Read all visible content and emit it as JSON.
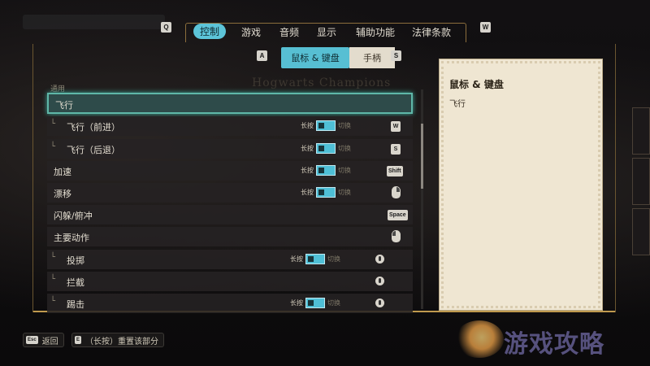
{
  "top_tabs": {
    "prev_key": "Q",
    "next_key": "W",
    "items": [
      {
        "label": "控制",
        "active": true
      },
      {
        "label": "游戏",
        "active": false
      },
      {
        "label": "音频",
        "active": false
      },
      {
        "label": "显示",
        "active": false
      },
      {
        "label": "辅助功能",
        "active": false
      },
      {
        "label": "法律条款",
        "active": false
      }
    ]
  },
  "sub_tabs": {
    "prev_key": "A",
    "next_key": "S",
    "active_label": "鼠标 & 键盘",
    "inactive_label": "手柄"
  },
  "list": {
    "section_label": "通用",
    "watermark_title": "Hogwarts Champions",
    "rows": [
      {
        "label": "飞行",
        "selected": true
      },
      {
        "label": "飞行（前进）",
        "sub": true,
        "toggle": {
          "hold": "长按",
          "alt": "切换"
        },
        "key": "W"
      },
      {
        "label": "飞行（后退）",
        "sub": true,
        "toggle": {
          "hold": "长按",
          "alt": "切换"
        },
        "key": "S"
      },
      {
        "label": "加速",
        "toggle": {
          "hold": "长按",
          "alt": "切换"
        },
        "key": "Shift"
      },
      {
        "label": "漂移",
        "toggle": {
          "hold": "长按",
          "alt": "切换"
        },
        "key_icon": "mouse-right-icon"
      },
      {
        "label": "闪躲/俯冲",
        "key": "Space"
      },
      {
        "label": "主要动作",
        "key_icon": "mouse-left-icon"
      },
      {
        "label": "投掷",
        "sub": true,
        "toggle": {
          "hold": "长按",
          "alt": "切换"
        },
        "key_icon": "mouse-wheel-icon"
      },
      {
        "label": "拦截",
        "sub": true,
        "key_icon": "mouse-wheel-icon"
      },
      {
        "label": "踢击",
        "sub": true,
        "toggle": {
          "hold": "长按",
          "alt": "切换"
        },
        "key_icon": "mouse-wheel-icon"
      }
    ]
  },
  "description": {
    "title": "鼠标 & 键盘",
    "body": "飞行"
  },
  "footer": {
    "back_key": "Esc",
    "back_label": "返回",
    "reset_key": "E",
    "reset_label": "（长按）重置该部分"
  },
  "watermark": {
    "text": "游戏攻略"
  },
  "colors": {
    "accent": "#5cc4d8",
    "selected_border": "#5fb7a8",
    "gold": "#c09a4e",
    "card": "#efe6d2"
  }
}
